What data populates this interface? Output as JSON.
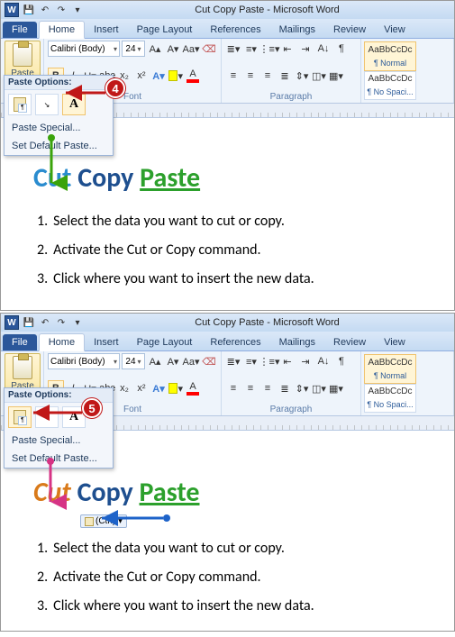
{
  "app": {
    "title": "Cut Copy Paste - Microsoft Word",
    "word_icon_letter": "W"
  },
  "tabs": {
    "file": "File",
    "home": "Home",
    "insert": "Insert",
    "pagelayout": "Page Layout",
    "references": "References",
    "mailings": "Mailings",
    "review": "Review",
    "view": "View"
  },
  "ribbon": {
    "clipboard_paste": "Paste",
    "font_name": "Calibri (Body)",
    "font_size": "24",
    "group_font": "Font",
    "group_paragraph": "Paragraph",
    "style_sample": "AaBbCcDc",
    "style_normal": "¶ Normal",
    "style_nospacing": "¶ No Spaci..."
  },
  "pastepanel": {
    "header": "Paste Options:",
    "paste_special": "Paste Special...",
    "set_default": "Set Default Paste...",
    "keep_text_glyph": "A"
  },
  "doc_title": {
    "cut": "Cut",
    "copy": "Copy",
    "paste": "Paste"
  },
  "doc_list": {
    "n1": "1.",
    "t1": "Select the data you want to cut or copy.",
    "n2": "2.",
    "t2": "Activate the Cut or Copy command.",
    "n3": "3.",
    "t3": "Click where you want to insert the new data."
  },
  "callouts": {
    "c4": "4",
    "c5": "5"
  },
  "smarttag": "(Ctrl) ▾"
}
